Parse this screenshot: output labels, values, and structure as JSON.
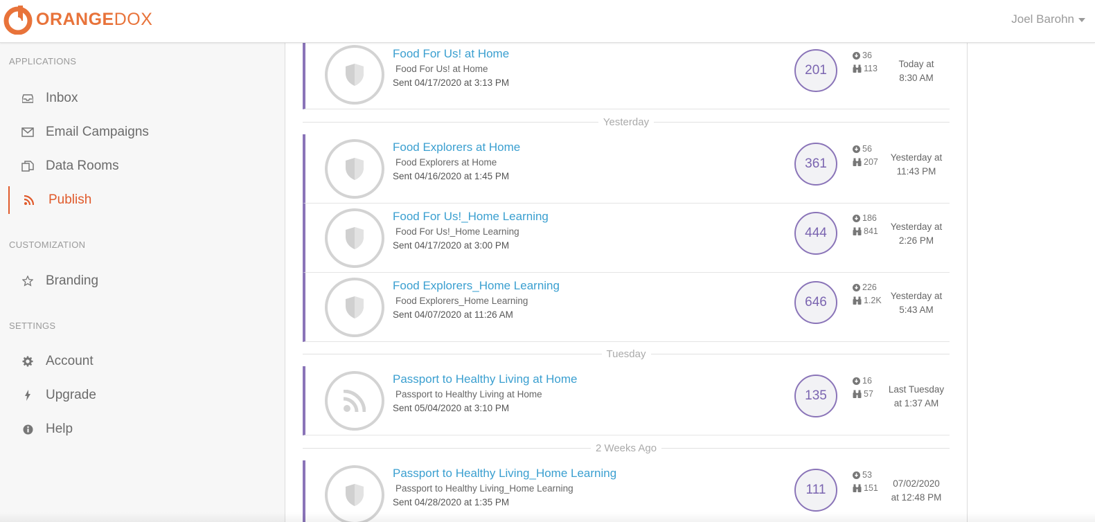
{
  "app": {
    "logo_text_a": "ORANGE",
    "logo_text_b": "DOX",
    "user_name": "Joel Barohn",
    "brand_color": "#e8733a",
    "accent_color": "#8a74b8",
    "link_color": "#3a9fd0"
  },
  "sidebar": {
    "sections": [
      {
        "title": "APPLICATIONS"
      },
      {
        "title": "CUSTOMIZATION"
      },
      {
        "title": "SETTINGS"
      }
    ],
    "items": [
      {
        "label": "Inbox",
        "icon": "inbox-icon"
      },
      {
        "label": "Email Campaigns",
        "icon": "envelope-icon"
      },
      {
        "label": "Data Rooms",
        "icon": "copy-icon"
      },
      {
        "label": "Publish",
        "icon": "rss-icon",
        "active": true
      },
      {
        "label": "Branding",
        "icon": "star-icon"
      },
      {
        "label": "Account",
        "icon": "gear-icon"
      },
      {
        "label": "Upgrade",
        "icon": "bolt-icon"
      },
      {
        "label": "Help",
        "icon": "info-icon"
      }
    ]
  },
  "dividers": [
    "Yesterday",
    "Tuesday",
    "2 Weeks Ago"
  ],
  "items": [
    {
      "title": "Food For Us! at Home",
      "subtitle": "Food For Us! at Home",
      "sent": "Sent 04/17/2020 at 3:13 PM",
      "count": "201",
      "downloads": "36",
      "views": "113",
      "when_1": "Today at",
      "when_2": "8:30 AM",
      "icon": "shield-icon"
    },
    {
      "title": "Food Explorers at Home",
      "subtitle": "Food Explorers at Home",
      "sent": "Sent 04/16/2020 at 1:45 PM",
      "count": "361",
      "downloads": "56",
      "views": "207",
      "when_1": "Yesterday at",
      "when_2": "11:43 PM",
      "icon": "shield-icon"
    },
    {
      "title": "Food For Us!_Home Learning",
      "subtitle": "Food For Us!_Home Learning",
      "sent": "Sent 04/17/2020 at 3:00 PM",
      "count": "444",
      "downloads": "186",
      "views": "841",
      "when_1": "Yesterday at",
      "when_2": "2:26 PM",
      "icon": "shield-icon"
    },
    {
      "title": "Food Explorers_Home Learning",
      "subtitle": "Food Explorers_Home Learning",
      "sent": "Sent 04/07/2020 at 11:26 AM",
      "count": "646",
      "downloads": "226",
      "views": "1.2K",
      "when_1": "Yesterday at",
      "when_2": "5:43 AM",
      "icon": "shield-icon"
    },
    {
      "title": "Passport to Healthy Living at Home",
      "subtitle": "Passport to Healthy Living at Home",
      "sent": "Sent 05/04/2020 at 3:10 PM",
      "count": "135",
      "downloads": "16",
      "views": "57",
      "when_1": "Last Tuesday",
      "when_2": "at 1:37 AM",
      "icon": "rss-icon"
    },
    {
      "title": "Passport to Healthy Living_Home Learning",
      "subtitle": "Passport to Healthy Living_Home Learning",
      "sent": "Sent 04/28/2020 at 1:35 PM",
      "count": "111",
      "downloads": "53",
      "views": "151",
      "when_1": "07/02/2020",
      "when_2": "at 12:48 PM",
      "icon": "shield-icon"
    }
  ]
}
